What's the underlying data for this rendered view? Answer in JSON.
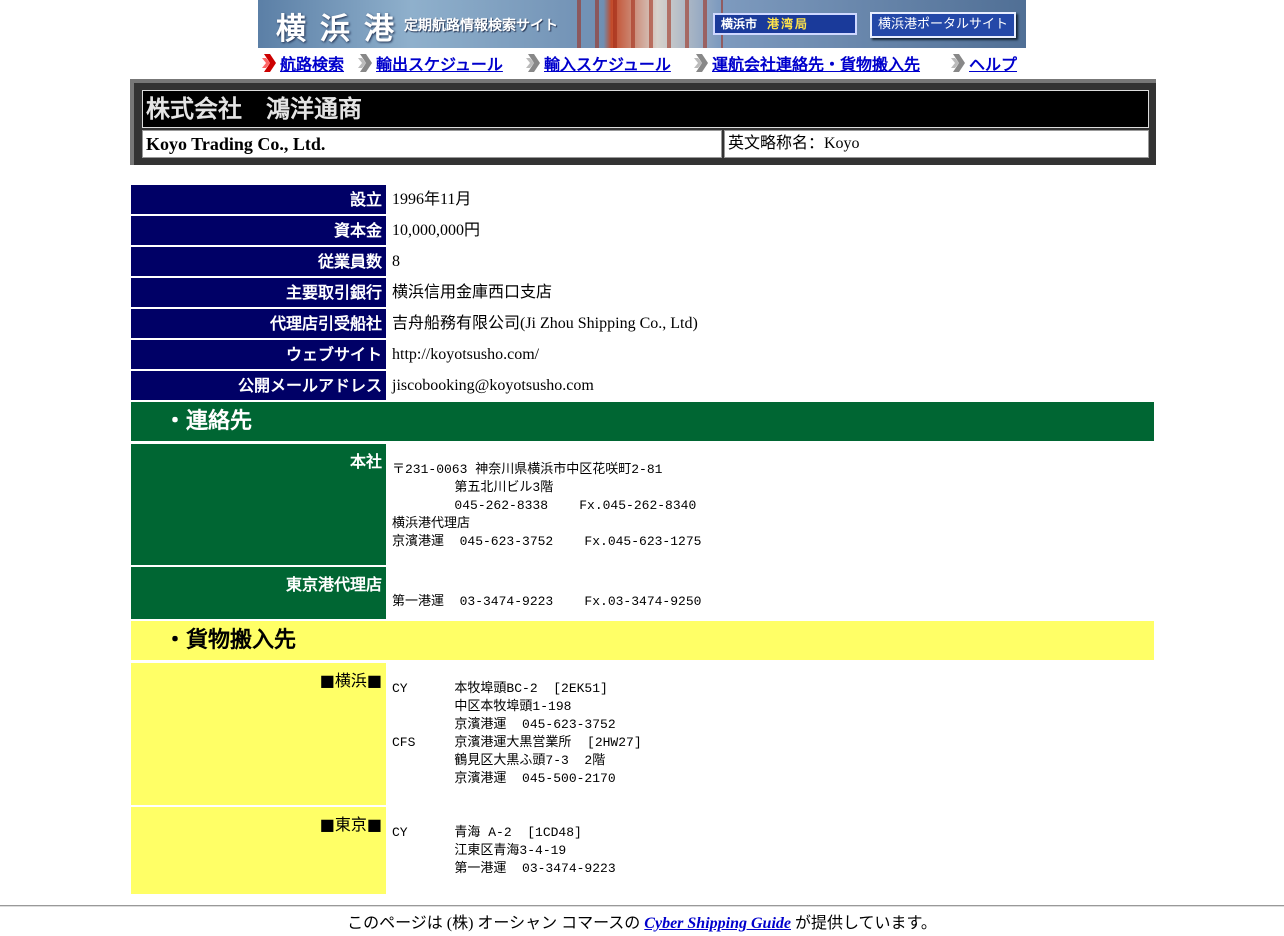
{
  "banner": {
    "title": "横浜港",
    "subtitle": "定期航路情報検索サイト",
    "bureau_prefix": "横浜市",
    "bureau_name": "港湾局",
    "portal_link": "横浜港ポータルサイト"
  },
  "nav": {
    "items": [
      {
        "label": "航路検索",
        "icon": "red-chevron-icon"
      },
      {
        "label": "輸出スケジュール",
        "icon": "gray-chevron-icon"
      },
      {
        "label": "輸入スケジュール",
        "icon": "gray-chevron-icon"
      },
      {
        "label": "運航会社連絡先・貨物搬入先",
        "icon": "gray-chevron-icon"
      },
      {
        "label": "ヘルプ",
        "icon": "gray-chevron-icon"
      }
    ]
  },
  "company": {
    "name_jp": "株式会社　鴻洋通商",
    "name_en": "Koyo Trading Co., Ltd.",
    "abbr": "英文略称名：Koyo"
  },
  "info": [
    {
      "label": "設立",
      "value": "1996年11月"
    },
    {
      "label": "資本金",
      "value": "10,000,000円"
    },
    {
      "label": "従業員数",
      "value": "8"
    },
    {
      "label": "主要取引銀行",
      "value": "横浜信用金庫西口支店"
    },
    {
      "label": "代理店引受船社",
      "value": "吉舟船務有限公司(Ji Zhou Shipping Co., Ltd)"
    },
    {
      "label": "ウェブサイト",
      "value": "http://koyotsusho.com/"
    },
    {
      "label": "公開メールアドレス",
      "value": "jiscobooking@koyotsusho.com"
    }
  ],
  "contacts": {
    "heading": "・連絡先",
    "blocks": [
      {
        "label": "本社",
        "text": "〒231-0063 神奈川県横浜市中区花咲町2-81\n        第五北川ビル3階\n        045-262-8338    Fx.045-262-8340\n横浜港代理店\n京濱港運  045-623-3752    Fx.045-623-1275"
      },
      {
        "label": "東京港代理店",
        "text": "\n第一港運  03-3474-9223    Fx.03-3474-9250"
      }
    ]
  },
  "cargo": {
    "heading": "・貨物搬入先",
    "blocks": [
      {
        "label": "■横浜■",
        "text": "CY      本牧埠頭BC-2  [2EK51]\n        中区本牧埠頭1-198\n        京濱港運  045-623-3752\nCFS     京濱港運大黒営業所  [2HW27]\n        鶴見区大黒ふ頭7-3  2階\n        京濱港運  045-500-2170"
      },
      {
        "label": "■東京■",
        "text": "CY      青海 A-2  [1CD48]\n        江東区青海3-4-19\n        第一港運  03-3474-9223"
      }
    ]
  },
  "footer": {
    "prefix": "このページは (株) オーシャン コマースの ",
    "link": "Cyber Shipping Guide",
    "suffix": " が提供しています。"
  }
}
